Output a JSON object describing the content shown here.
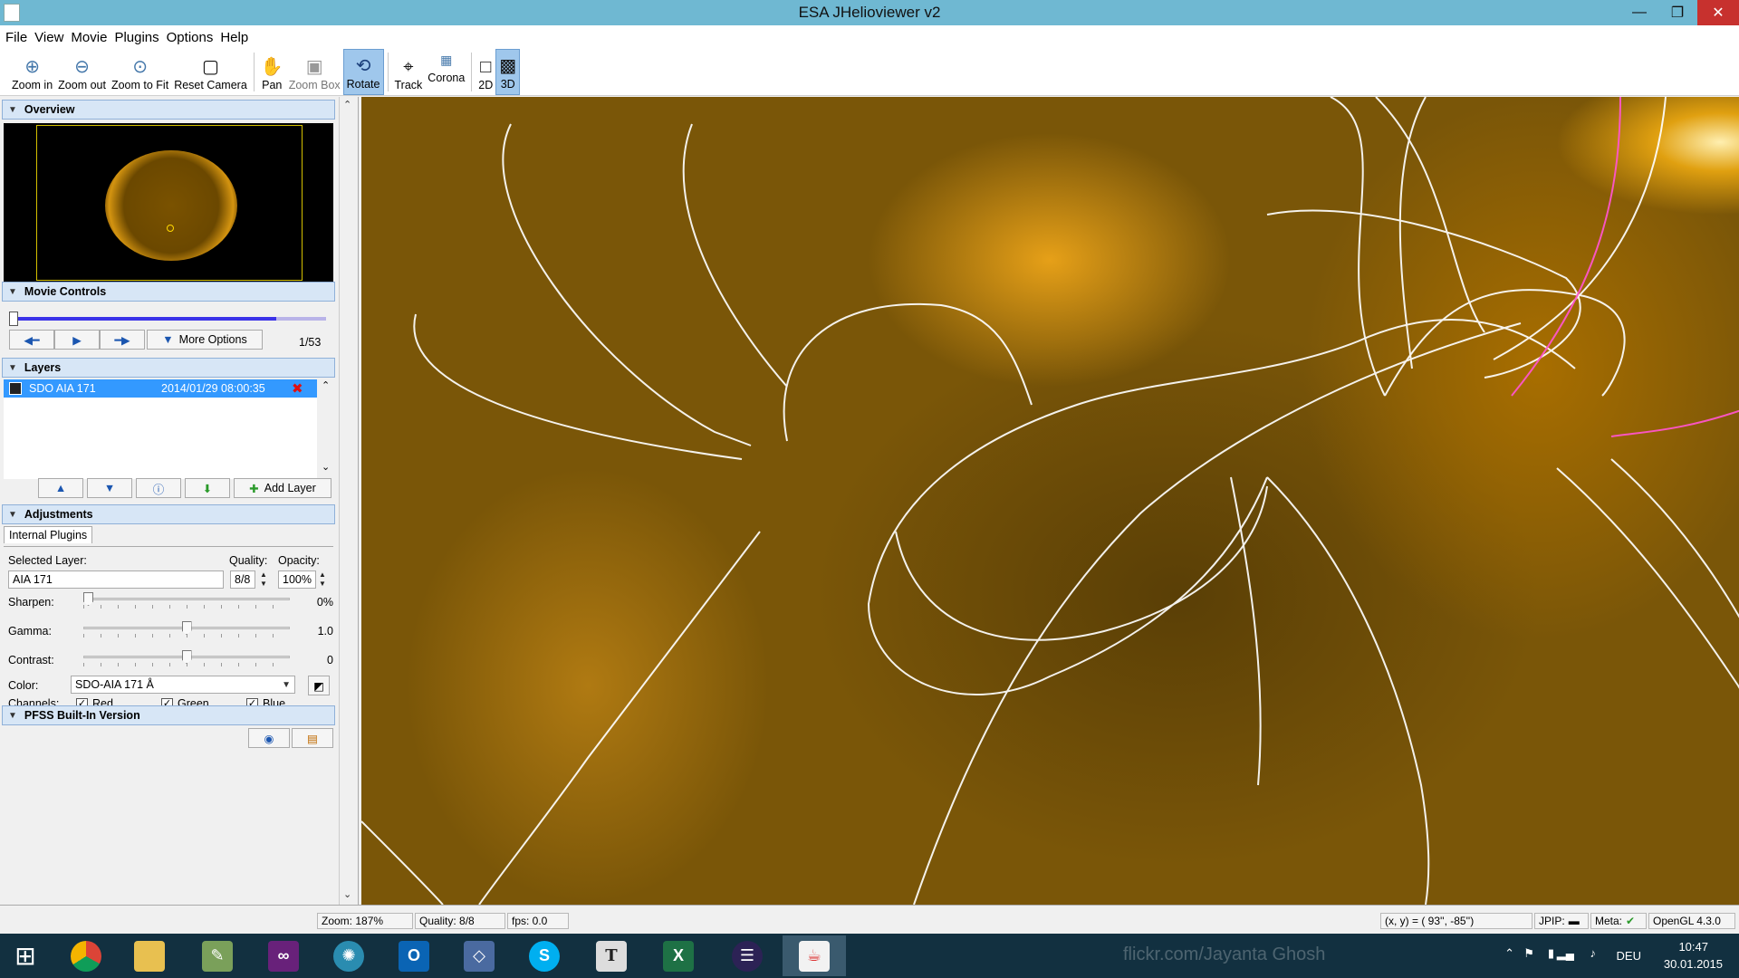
{
  "window": {
    "title": "ESA JHelioviewer v2",
    "minimize": "—",
    "maximize": "❐",
    "close": "✕"
  },
  "menu": [
    "File",
    "View",
    "Movie",
    "Plugins",
    "Options",
    "Help"
  ],
  "toolbar": {
    "zoom_in": "Zoom in",
    "zoom_out": "Zoom out",
    "zoom_fit": "Zoom to Fit",
    "reset_camera": "Reset Camera",
    "pan": "Pan",
    "zoom_box": "Zoom Box",
    "rotate": "Rotate",
    "track": "Track",
    "corona": "Corona",
    "mode_2d": "2D",
    "mode_3d": "3D"
  },
  "overview": {
    "header": "Overview"
  },
  "movie_controls": {
    "header": "Movie Controls",
    "progress": 0.84,
    "more_options": "More Options",
    "frame": "1/53"
  },
  "layers": {
    "header": "Layers",
    "items": [
      {
        "name": "SDO AIA 171",
        "date": "2014/01/29 08:00:35"
      }
    ],
    "add_layer": "Add Layer"
  },
  "adjustments": {
    "header": "Adjustments",
    "tab": "Internal Plugins",
    "selected_layer_label": "Selected Layer:",
    "selected_layer_value": "AIA 171",
    "quality_label": "Quality:",
    "quality_value": "8/8",
    "opacity_label": "Opacity:",
    "opacity_value": "100%",
    "sharpen_label": "Sharpen:",
    "sharpen_value": "0%",
    "sharpen_level": 0.0,
    "gamma_label": "Gamma:",
    "gamma_value": "1.0",
    "gamma_level": 0.5,
    "contrast_label": "Contrast:",
    "contrast_value": "0",
    "contrast_level": 0.5,
    "color_label": "Color:",
    "color_value": "SDO-AIA 171 Å",
    "channels_label": "Channels:",
    "channels": [
      {
        "label": "Red",
        "checked": true
      },
      {
        "label": "Green",
        "checked": true
      },
      {
        "label": "Blue",
        "checked": true
      }
    ]
  },
  "pfss": {
    "header": "PFSS Built-In Version"
  },
  "status": {
    "zoom": "Zoom: 187%",
    "quality": "Quality: 8/8",
    "fps": "fps: 0.0",
    "coords": "(x, y) = (    93'',   -85'')",
    "jpip": "JPIP:",
    "meta": "Meta:",
    "opengl": "OpenGL 4.3.0"
  },
  "taskbar": {
    "watermark": "flickr.com/Jayanta Ghosh",
    "lang": "DEU",
    "time": "10:47",
    "date": "30.01.2015"
  },
  "colors": {
    "selection": "#3399ff",
    "header_bg": "#d7e6f6",
    "field_line": "#ffffff",
    "open_field_line": "#ff55cc"
  }
}
